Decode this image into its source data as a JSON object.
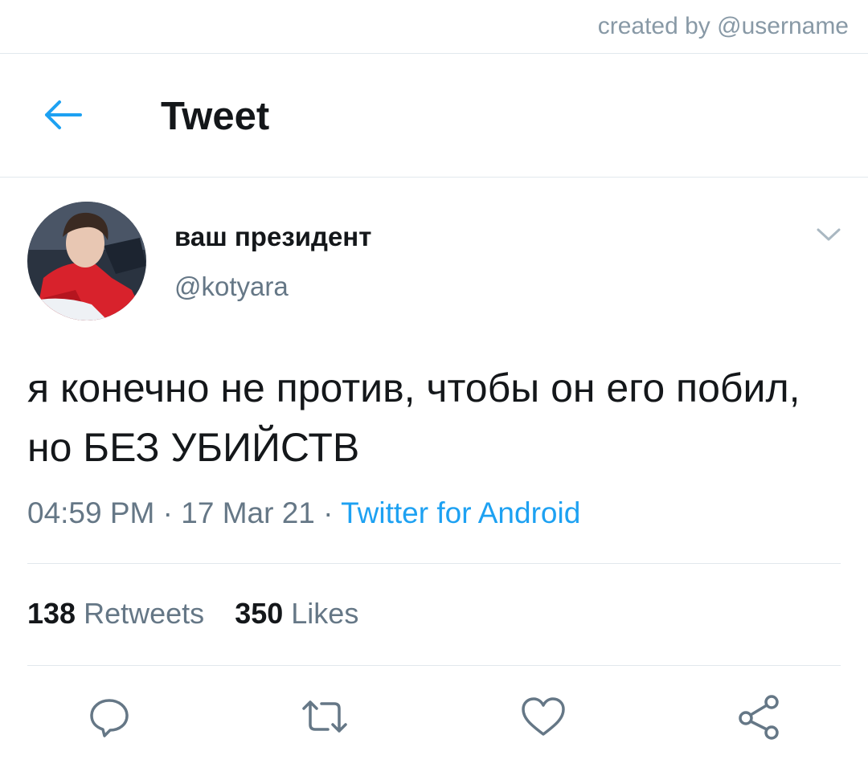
{
  "credit": "created by @username",
  "header": {
    "back_icon": "arrow-left-icon",
    "title": "Tweet"
  },
  "tweet": {
    "display_name": "ваш президент",
    "handle": "@kotyara",
    "text": "я конечно не против, чтобы он его побил, но БЕЗ УБИЙСТВ",
    "time": "04:59 PM",
    "date": "17 Mar 21",
    "separator": "·",
    "source": "Twitter for Android"
  },
  "stats": {
    "retweets_count": "138",
    "retweets_label": "Retweets",
    "likes_count": "350",
    "likes_label": "Likes"
  },
  "actions": [
    "reply-icon",
    "retweet-icon",
    "like-icon",
    "share-icon"
  ],
  "colors": {
    "accent": "#1da1f2",
    "text": "#14171a",
    "secondary_text": "#657786",
    "divider": "#e1e8ed",
    "icon": "#657786"
  }
}
